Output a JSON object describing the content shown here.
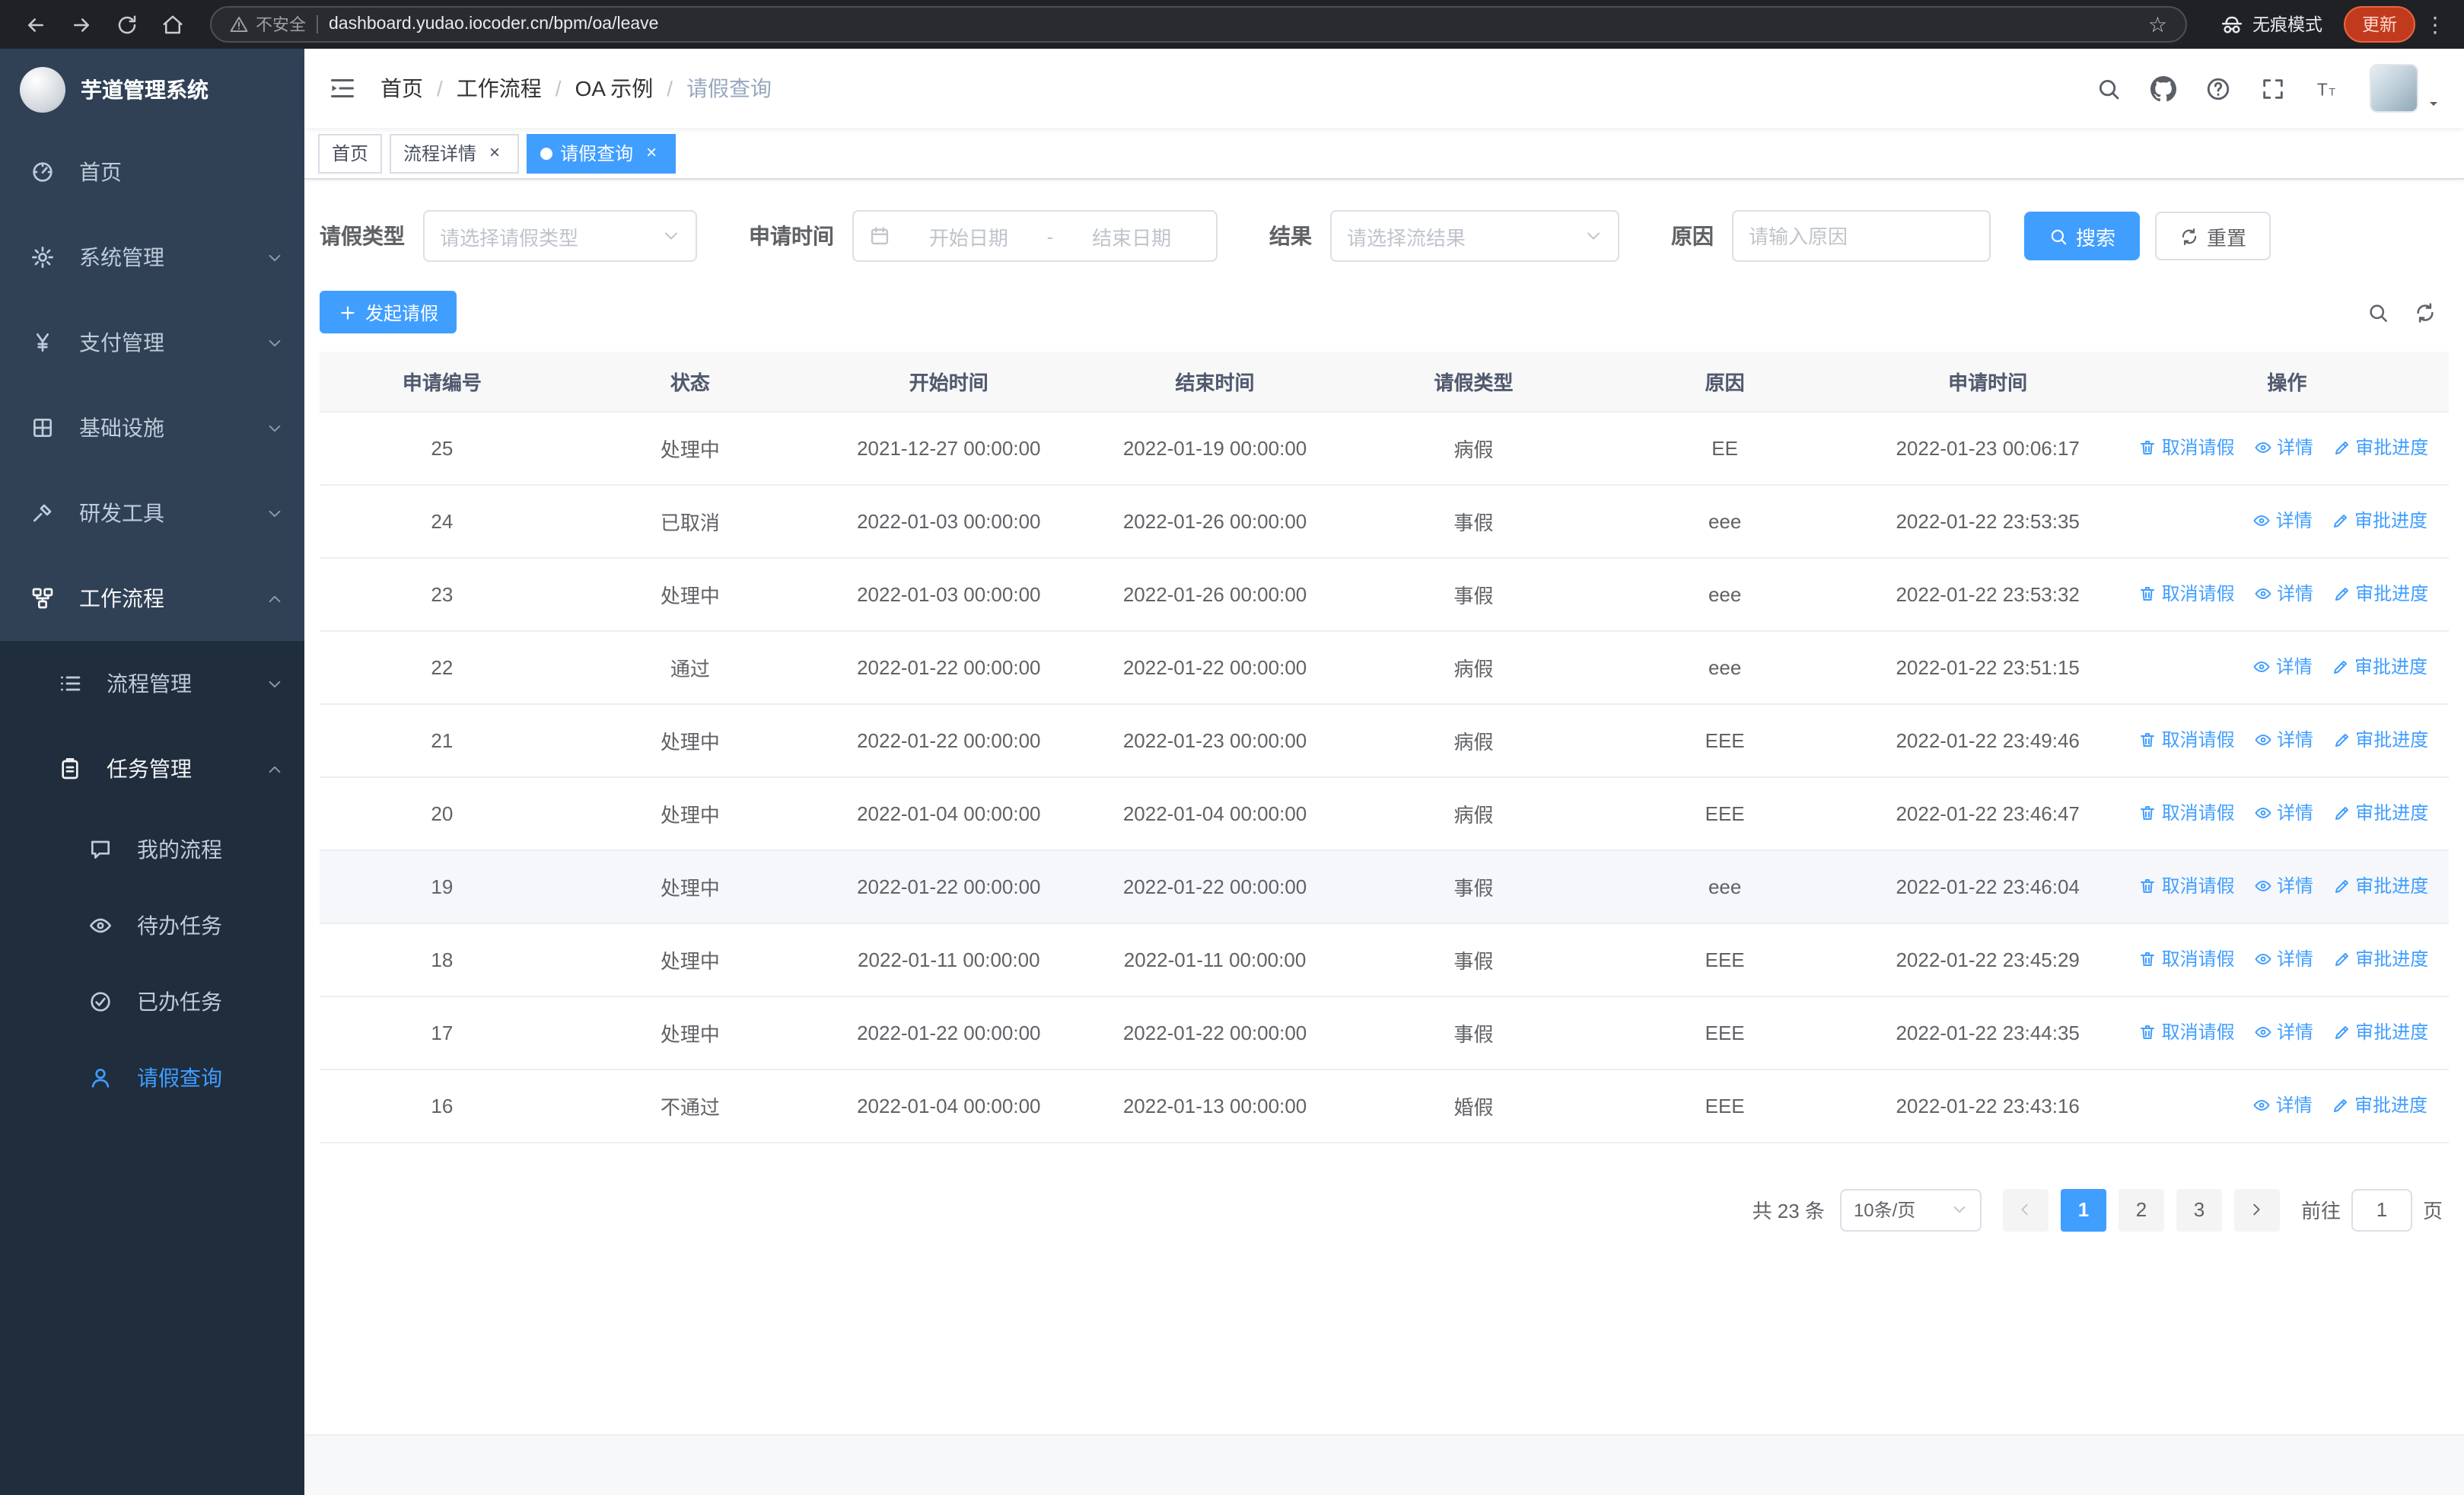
{
  "colors": {
    "accent": "#409eff",
    "sidebar_bg": "#304156",
    "submenu_bg": "#1f2d3d",
    "header_bg": "#f8f8f9",
    "update_button": "#c23a1e"
  },
  "browser": {
    "security_warning": "不安全",
    "url": "dashboard.yudao.iocoder.cn/bpm/oa/leave",
    "incognito_label": "无痕模式",
    "update_button": "更新"
  },
  "sidebar": {
    "logo_title": "芋道管理系统",
    "menu": [
      {
        "id": "home",
        "label": "首页",
        "icon": "gauge-icon",
        "level": 1
      },
      {
        "id": "system",
        "label": "系统管理",
        "icon": "gear-icon",
        "level": 1,
        "arrow": "down"
      },
      {
        "id": "payment",
        "label": "支付管理",
        "icon": "yen-icon",
        "level": 1,
        "arrow": "down"
      },
      {
        "id": "infra",
        "label": "基础设施",
        "icon": "grid-icon",
        "level": 1,
        "arrow": "down"
      },
      {
        "id": "devtools",
        "label": "研发工具",
        "icon": "hammer-icon",
        "level": 1,
        "arrow": "down"
      },
      {
        "id": "workflow",
        "label": "工作流程",
        "icon": "flow-icon",
        "level": 1,
        "arrow": "up",
        "open": true
      },
      {
        "id": "process-mgmt",
        "label": "流程管理",
        "icon": "list-icon",
        "level": 2,
        "arrow": "down"
      },
      {
        "id": "task-mgmt",
        "label": "任务管理",
        "icon": "clipboard-icon",
        "level": 2,
        "arrow": "up",
        "open": true
      },
      {
        "id": "my-process",
        "label": "我的流程",
        "icon": "chat-icon",
        "level": 3
      },
      {
        "id": "todo-tasks",
        "label": "待办任务",
        "icon": "eye-icon",
        "level": 3
      },
      {
        "id": "done-tasks",
        "label": "已办任务",
        "icon": "check-icon",
        "level": 3
      },
      {
        "id": "leave-query",
        "label": "请假查询",
        "icon": "user-icon",
        "level": 3,
        "active": true
      }
    ]
  },
  "header": {
    "separator": "/",
    "breadcrumb": [
      "首页",
      "工作流程",
      "OA 示例",
      "请假查询"
    ]
  },
  "tabs": [
    {
      "id": "home",
      "label": "首页",
      "closable": false,
      "active": false
    },
    {
      "id": "process-detail",
      "label": "流程详情",
      "closable": true,
      "active": false
    },
    {
      "id": "leave-query",
      "label": "请假查询",
      "closable": true,
      "active": true
    }
  ],
  "filters": {
    "leave_type_label": "请假类型",
    "leave_type_placeholder": "请选择请假类型",
    "apply_time_label": "申请时间",
    "start_date_placeholder": "开始日期",
    "range_separator": "-",
    "end_date_placeholder": "结束日期",
    "result_label": "结果",
    "result_placeholder": "请选择流结果",
    "reason_label": "原因",
    "reason_placeholder": "请输入原因",
    "search_button": "搜索",
    "reset_button": "重置"
  },
  "toolbar": {
    "create_button": "发起请假"
  },
  "table": {
    "columns": [
      "申请编号",
      "状态",
      "开始时间",
      "结束时间",
      "请假类型",
      "原因",
      "申请时间",
      "操作"
    ],
    "actions": {
      "cancel": "取消请假",
      "detail": "详情",
      "progress": "审批进度"
    },
    "rows": [
      {
        "id": "25",
        "status": "处理中",
        "start": "2021-12-27 00:00:00",
        "end": "2022-01-19 00:00:00",
        "type": "病假",
        "reason": "EE",
        "apply_time": "2022-01-23 00:06:17",
        "can_cancel": true
      },
      {
        "id": "24",
        "status": "已取消",
        "start": "2022-01-03 00:00:00",
        "end": "2022-01-26 00:00:00",
        "type": "事假",
        "reason": "eee",
        "apply_time": "2022-01-22 23:53:35",
        "can_cancel": false
      },
      {
        "id": "23",
        "status": "处理中",
        "start": "2022-01-03 00:00:00",
        "end": "2022-01-26 00:00:00",
        "type": "事假",
        "reason": "eee",
        "apply_time": "2022-01-22 23:53:32",
        "can_cancel": true
      },
      {
        "id": "22",
        "status": "通过",
        "start": "2022-01-22 00:00:00",
        "end": "2022-01-22 00:00:00",
        "type": "病假",
        "reason": "eee",
        "apply_time": "2022-01-22 23:51:15",
        "can_cancel": false
      },
      {
        "id": "21",
        "status": "处理中",
        "start": "2022-01-22 00:00:00",
        "end": "2022-01-23 00:00:00",
        "type": "病假",
        "reason": "EEE",
        "apply_time": "2022-01-22 23:49:46",
        "can_cancel": true
      },
      {
        "id": "20",
        "status": "处理中",
        "start": "2022-01-04 00:00:00",
        "end": "2022-01-04 00:00:00",
        "type": "病假",
        "reason": "EEE",
        "apply_time": "2022-01-22 23:46:47",
        "can_cancel": true
      },
      {
        "id": "19",
        "status": "处理中",
        "start": "2022-01-22 00:00:00",
        "end": "2022-01-22 00:00:00",
        "type": "事假",
        "reason": "eee",
        "apply_time": "2022-01-22 23:46:04",
        "can_cancel": true,
        "highlighted": true
      },
      {
        "id": "18",
        "status": "处理中",
        "start": "2022-01-11 00:00:00",
        "end": "2022-01-11 00:00:00",
        "type": "事假",
        "reason": "EEE",
        "apply_time": "2022-01-22 23:45:29",
        "can_cancel": true
      },
      {
        "id": "17",
        "status": "处理中",
        "start": "2022-01-22 00:00:00",
        "end": "2022-01-22 00:00:00",
        "type": "事假",
        "reason": "EEE",
        "apply_time": "2022-01-22 23:44:35",
        "can_cancel": true
      },
      {
        "id": "16",
        "status": "不通过",
        "start": "2022-01-04 00:00:00",
        "end": "2022-01-13 00:00:00",
        "type": "婚假",
        "reason": "EEE",
        "apply_time": "2022-01-22 23:43:16",
        "can_cancel": false
      }
    ]
  },
  "pagination": {
    "total_text": "共 23 条",
    "page_size": "10条/页",
    "pages": [
      "1",
      "2",
      "3"
    ],
    "active_page": "1",
    "goto_label": "前往",
    "goto_value": "1",
    "goto_suffix": "页"
  }
}
